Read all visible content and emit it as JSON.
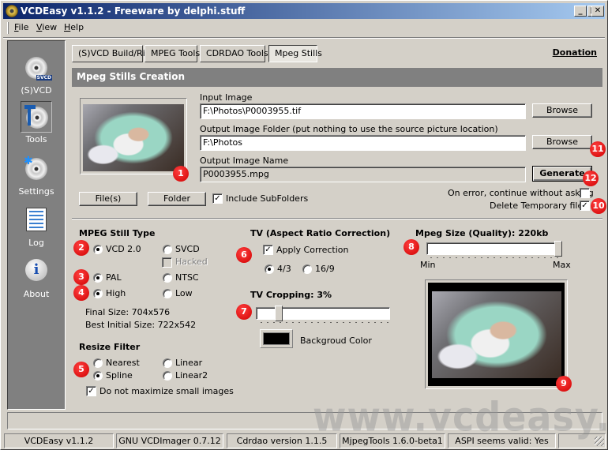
{
  "window": {
    "title": "VCDEasy v1.1.2 - Freeware by delphi.stuff",
    "controls": [
      "minimize",
      "maximize",
      "close"
    ]
  },
  "menu": {
    "items": [
      {
        "label": "File",
        "accel": "F"
      },
      {
        "label": "View",
        "accel": "V"
      },
      {
        "label": "Help",
        "accel": "H"
      }
    ]
  },
  "sidebar": {
    "items": [
      {
        "label": "(S)VCD",
        "icon": "svcd-disc-icon"
      },
      {
        "label": "Tools",
        "icon": "tools-disc-icon",
        "selected": true
      },
      {
        "label": "Settings",
        "icon": "settings-disc-icon"
      },
      {
        "label": "Log",
        "icon": "log-document-icon"
      },
      {
        "label": "About",
        "icon": "info-bubble-icon"
      }
    ],
    "svcd_badge": "SVCD"
  },
  "tabs": [
    {
      "label": "(S)VCD Build/Rip"
    },
    {
      "label": "MPEG Tools"
    },
    {
      "label": "CDRDAO Tools"
    },
    {
      "label": "Mpeg Stills",
      "active": true
    }
  ],
  "donation_link": "Donation",
  "panel": {
    "title": "Mpeg Stills Creation",
    "input_image": {
      "label": "Input Image",
      "value": "F:\\Photos\\P0003955.tif",
      "browse": "Browse"
    },
    "output_folder": {
      "label": "Output Image Folder (put nothing to use the source picture location)",
      "value": "F:\\Photos",
      "browse": "Browse"
    },
    "output_name": {
      "label": "Output Image Name",
      "value": "P0003955.mpg",
      "generate": "Generate"
    },
    "files_button": "File(s)",
    "folder_button": "Folder",
    "include_subfolders": {
      "label": "Include SubFolders",
      "checked": true
    },
    "on_error_continue": {
      "label": "On error, continue without asking",
      "checked": false
    },
    "delete_temp": {
      "label": "Delete Temporary files",
      "checked": true
    }
  },
  "still_type": {
    "title": "MPEG Still Type",
    "vcd20": {
      "label": "VCD 2.0",
      "selected": true
    },
    "svcd": {
      "label": "SVCD",
      "selected": false
    },
    "hacked": {
      "label": "Hacked",
      "checked": false,
      "disabled": true
    },
    "pal": {
      "label": "PAL",
      "selected": true
    },
    "ntsc": {
      "label": "NTSC",
      "selected": false
    },
    "high": {
      "label": "High",
      "selected": true
    },
    "low": {
      "label": "Low",
      "selected": false
    },
    "final_size": "Final Size: 704x576",
    "best_initial_size": "Best Initial Size: 722x542"
  },
  "resize_filter": {
    "title": "Resize Filter",
    "nearest": {
      "label": "Nearest",
      "selected": false
    },
    "linear": {
      "label": "Linear",
      "selected": false
    },
    "spline": {
      "label": "Spline",
      "selected": true
    },
    "linear2": {
      "label": "Linear2",
      "selected": false
    },
    "no_maximize": {
      "label": "Do not maximize small images",
      "checked": true
    }
  },
  "tv": {
    "title": "TV (Aspect Ratio Correction)",
    "apply_correction": {
      "label": "Apply Correction",
      "checked": true
    },
    "ratio_43": {
      "label": "4/3",
      "selected": true
    },
    "ratio_169": {
      "label": "16/9",
      "selected": false
    },
    "cropping_title": "TV Cropping: 3%",
    "cropping_value_percent": 3,
    "background_color_label": "Backgroud Color",
    "background_color": "#000000"
  },
  "mpeg_size": {
    "title": "Mpeg Size (Quality): 220kb",
    "min_label": "Min",
    "max_label": "Max",
    "slider_fraction": 1.0
  },
  "callouts": [
    "1",
    "2",
    "3",
    "4",
    "5",
    "6",
    "7",
    "8",
    "9",
    "10",
    "11",
    "12"
  ],
  "watermark": "www.vcdeasy.org",
  "statusbar": [
    "VCDEasy v1.1.2",
    "GNU VCDImager 0.7.12",
    "Cdrdao version 1.1.5",
    "MjpegTools 1.6.0-beta1",
    "ASPI seems valid: Yes",
    ""
  ]
}
